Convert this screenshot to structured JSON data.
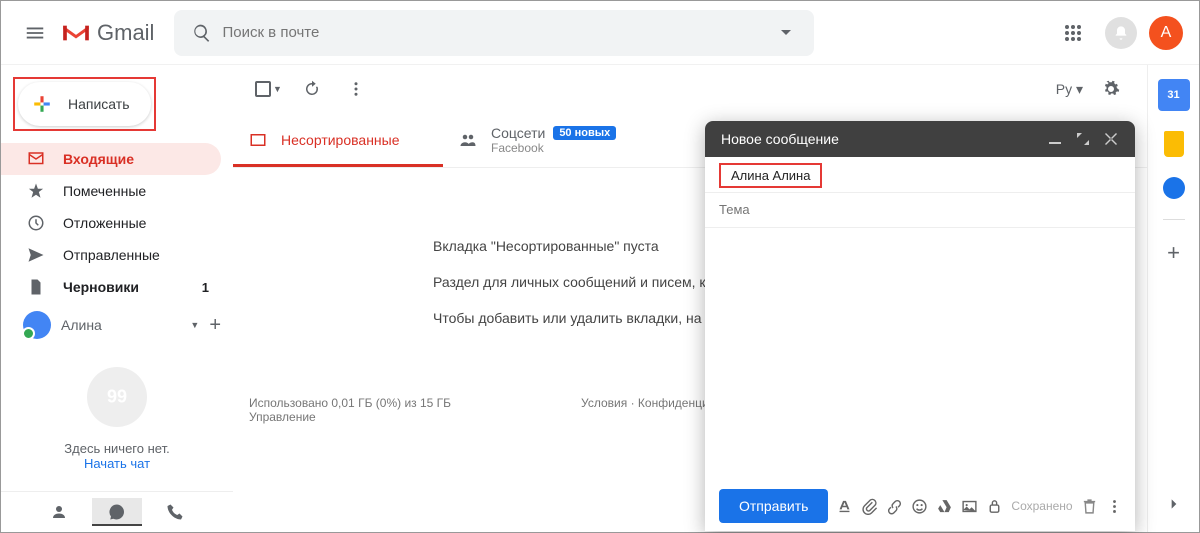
{
  "header": {
    "logo_text": "Gmail",
    "search_placeholder": "Поиск в почте",
    "avatar_letter": "А"
  },
  "sidebar": {
    "compose_label": "Написать",
    "items": [
      {
        "label": "Входящие",
        "count": ""
      },
      {
        "label": "Помеченные",
        "count": ""
      },
      {
        "label": "Отложенные",
        "count": ""
      },
      {
        "label": "Отправленные",
        "count": ""
      },
      {
        "label": "Черновики",
        "count": "1"
      }
    ],
    "chat_user": "Алина",
    "hangouts_empty": "Здесь ничего нет.",
    "hangouts_start": "Начать чат"
  },
  "toolbar": {
    "lang": "Ру"
  },
  "tabs": {
    "primary": "Несортированные",
    "social": "Соцсети",
    "social_badge": "50 новых",
    "social_sub": "Facebook"
  },
  "empty": {
    "line1": "Вкладка \"Несортированные\" пуста",
    "line2": "Раздел для личных сообщений и писем, к",
    "line3": "Чтобы добавить или удалить вкладки, на"
  },
  "footer": {
    "storage_line1": "Использовано 0,01 ГБ (0%) из 15 ГБ",
    "storage_line2": "Управление",
    "terms": "Условия · Конфиденциальн"
  },
  "compose": {
    "title": "Новое сообщение",
    "recipient": "Алина Алина",
    "subject_placeholder": "Тема",
    "send": "Отправить",
    "saved": "Сохранено"
  },
  "rightpanel": {
    "calendar_day": "31"
  }
}
